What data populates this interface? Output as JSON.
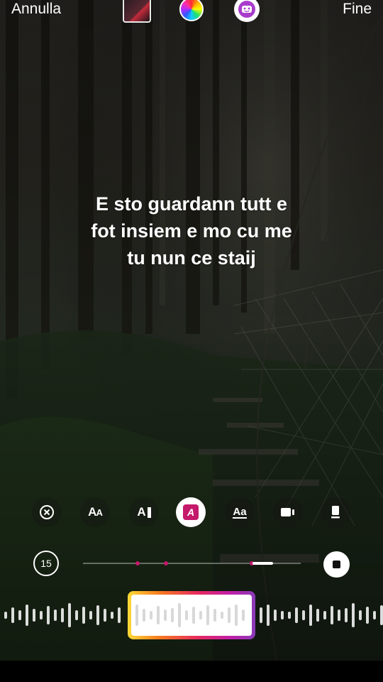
{
  "header": {
    "cancel_label": "Annulla",
    "done_label": "Fine",
    "thumbnail_icon": "album-art-thumbnail",
    "color_icon": "color-wheel-icon",
    "sticker_icon": "sticker-face-icon"
  },
  "caption": {
    "lines": [
      "E sto guardann tutt e",
      "fot insiem e mo cu me",
      "tu nun ce staij"
    ]
  },
  "toolbar": {
    "tools": [
      {
        "name": "close-icon"
      },
      {
        "name": "text-size-icon",
        "label": "AA"
      },
      {
        "name": "text-cursor-icon",
        "label": "A"
      },
      {
        "name": "text-color-icon",
        "label": "A",
        "active": true
      },
      {
        "name": "font-style-icon",
        "label": "Aa"
      },
      {
        "name": "video-icon"
      },
      {
        "name": "layout-icon"
      }
    ]
  },
  "timeline": {
    "duration_label": "15",
    "progress": 0.87
  },
  "colors": {
    "accent": "#c4196b",
    "gradient_start": "#feda36",
    "gradient_end": "#8a3ab9"
  }
}
